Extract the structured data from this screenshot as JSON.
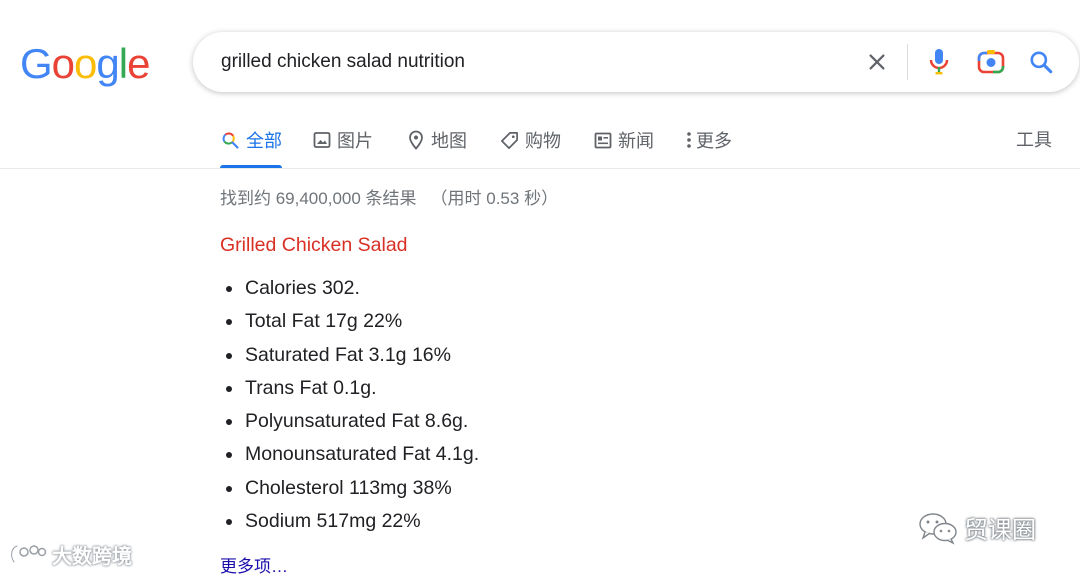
{
  "logo": {
    "letters": [
      "G",
      "o",
      "o",
      "g",
      "l",
      "e"
    ],
    "colors": [
      "#4285F4",
      "#EA4335",
      "#FBBC05",
      "#4285F4",
      "#34A853",
      "#EA4335"
    ]
  },
  "search": {
    "query": "grilled chicken salad nutrition",
    "icons": [
      "close-icon",
      "microphone-icon",
      "camera-lens-icon",
      "search-icon"
    ]
  },
  "tabs": [
    {
      "label": "全部",
      "icon": "search-icon",
      "active": true
    },
    {
      "label": "图片",
      "icon": "image-icon"
    },
    {
      "label": "地图",
      "icon": "map-pin-icon"
    },
    {
      "label": "购物",
      "icon": "tag-icon"
    },
    {
      "label": "新闻",
      "icon": "newspaper-icon"
    },
    {
      "label": "更多",
      "icon": "more-vert-icon"
    }
  ],
  "tools_label": "工具",
  "stats": {
    "count": "找到约 69,400,000 条结果",
    "time": "（用时 0.53 秒）"
  },
  "result": {
    "title": "Grilled Chicken Salad",
    "facts": [
      "Calories 302.",
      "Total Fat 17g 22%",
      "Saturated Fat 3.1g 16%",
      "Trans Fat 0.1g.",
      "Polyunsaturated Fat 8.6g.",
      "Monounsaturated Fat 4.1g.",
      "Cholesterol 113mg 38%",
      "Sodium 517mg 22%"
    ],
    "more_label": "更多项…"
  },
  "watermarks": {
    "left": "大数跨境",
    "right": "贸课圈"
  },
  "colors": {
    "accent": "#1a73e8",
    "title_red": "#d93025",
    "link": "#1a0dab",
    "muted": "#70757a"
  }
}
